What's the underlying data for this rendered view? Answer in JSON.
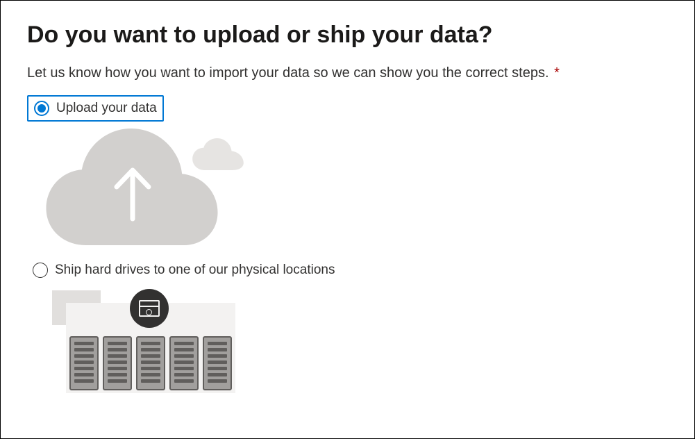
{
  "title": "Do you want to upload or ship your data?",
  "subtitle": "Let us know how you want to import your data so we can show you the correct steps.",
  "required_marker": "*",
  "options": {
    "upload": {
      "label": "Upload your data"
    },
    "ship": {
      "label": "Ship hard drives to one of our physical locations"
    }
  }
}
